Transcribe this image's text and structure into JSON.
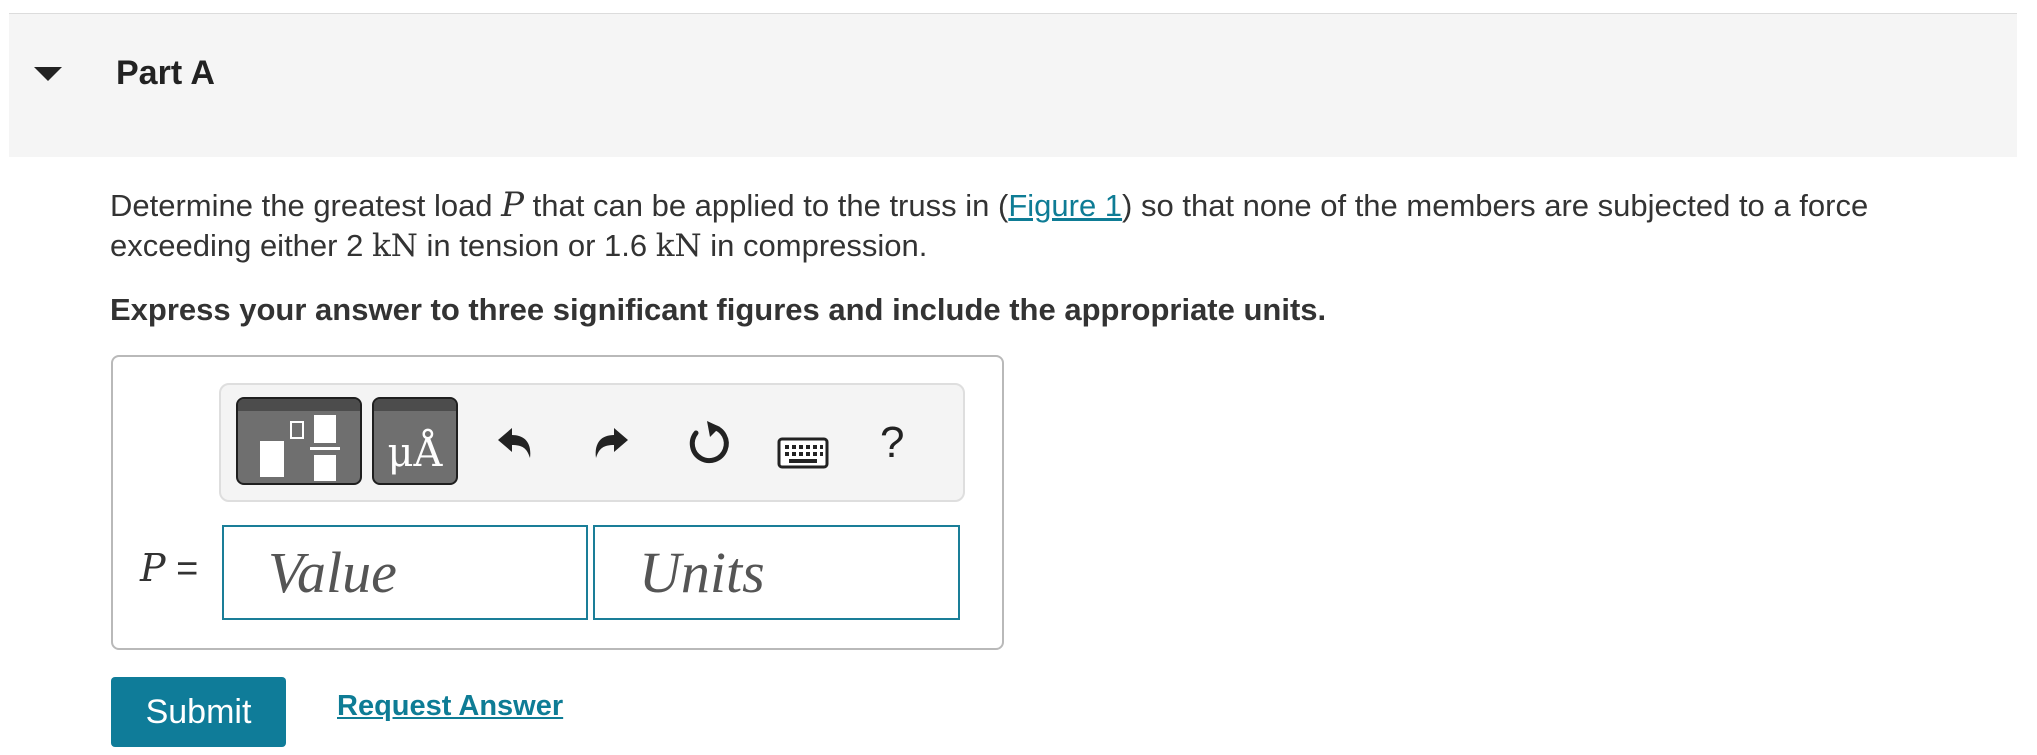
{
  "part": {
    "title": "Part A",
    "toggle_icon": "caret-down-icon"
  },
  "prompt": {
    "text_1": "Determine the greatest load ",
    "var_p": "P",
    "text_2": " that can be applied to the truss in (",
    "figure_link": "Figure 1",
    "text_3": ") so that none of the members are subjected to a force exceeding either ",
    "tension_value": "2",
    "tension_unit": "kN",
    "text_4": " in tension or ",
    "compression_value": "1.6",
    "compression_unit": "kN",
    "text_5": " in compression."
  },
  "instruction": "Express your answer to three significant figures and include the appropriate units.",
  "toolbar": {
    "units_label": "μÅ",
    "help_label": "?",
    "icons": [
      "templates-icon",
      "units-icon",
      "undo-icon",
      "redo-icon",
      "reset-icon",
      "keyboard-icon",
      "help-icon"
    ]
  },
  "answer": {
    "variable": "P",
    "equals": " =",
    "value_placeholder": "Value",
    "units_placeholder": "Units"
  },
  "actions": {
    "submit_label": "Submit",
    "request_label": "Request Answer"
  },
  "colors": {
    "accent": "#0f7c99",
    "link": "#0e7c95",
    "input_border": "#1a7e98"
  }
}
